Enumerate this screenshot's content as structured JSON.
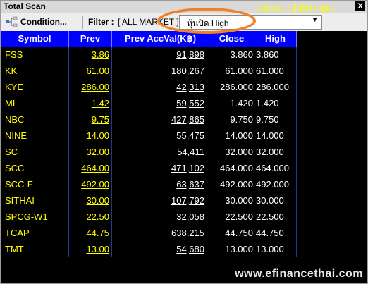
{
  "window": {
    "title": "Total Scan",
    "title_extra": "Criteria : [ หุ้นปิด High ]",
    "close_label": "X"
  },
  "toolbar": {
    "condition_label": "Condition...",
    "filter_label": "Filter :",
    "filter_value": "[ ALL MARKET ]",
    "criteria_selected": "หุ้นปิด High"
  },
  "table": {
    "headers": [
      "Symbol",
      "Prev",
      "Prev AccVal(K฿)",
      "Close",
      "High"
    ],
    "rows": [
      {
        "symbol": "FSS",
        "prev": "3.86",
        "acc": "91,898",
        "close": "3.860",
        "high": "3.860"
      },
      {
        "symbol": "KK",
        "prev": "61.00",
        "acc": "180,267",
        "close": "61.000",
        "high": "61.000"
      },
      {
        "symbol": "KYE",
        "prev": "286.00",
        "acc": "42,313",
        "close": "286.000",
        "high": "286.000"
      },
      {
        "symbol": "ML",
        "prev": "1.42",
        "acc": "59,552",
        "close": "1.420",
        "high": "1.420"
      },
      {
        "symbol": "NBC",
        "prev": "9.75",
        "acc": "427,865",
        "close": "9.750",
        "high": "9.750"
      },
      {
        "symbol": "NINE",
        "prev": "14.00",
        "acc": "55,475",
        "close": "14.000",
        "high": "14.000"
      },
      {
        "symbol": "SC",
        "prev": "32.00",
        "acc": "54,411",
        "close": "32.000",
        "high": "32.000"
      },
      {
        "symbol": "SCC",
        "prev": "464.00",
        "acc": "471,102",
        "close": "464.000",
        "high": "464.000"
      },
      {
        "symbol": "SCC-F",
        "prev": "492.00",
        "acc": "63,637",
        "close": "492.000",
        "high": "492.000"
      },
      {
        "symbol": "SITHAI",
        "prev": "30.00",
        "acc": "107,792",
        "close": "30.000",
        "high": "30.000"
      },
      {
        "symbol": "SPCG-W1",
        "prev": "22.50",
        "acc": "32,058",
        "close": "22.500",
        "high": "22.500"
      },
      {
        "symbol": "TCAP",
        "prev": "44.75",
        "acc": "638,215",
        "close": "44.750",
        "high": "44.750"
      },
      {
        "symbol": "TMT",
        "prev": "13.00",
        "acc": "54,680",
        "close": "13.000",
        "high": "13.000"
      }
    ]
  },
  "watermark": "www.efinancethai.com",
  "colors": {
    "header_bg": "#0000ff",
    "grid_bg": "#000000",
    "symbol_text": "#ffff00",
    "value_text": "#ffffff",
    "highlight_ring": "#f0802a"
  }
}
